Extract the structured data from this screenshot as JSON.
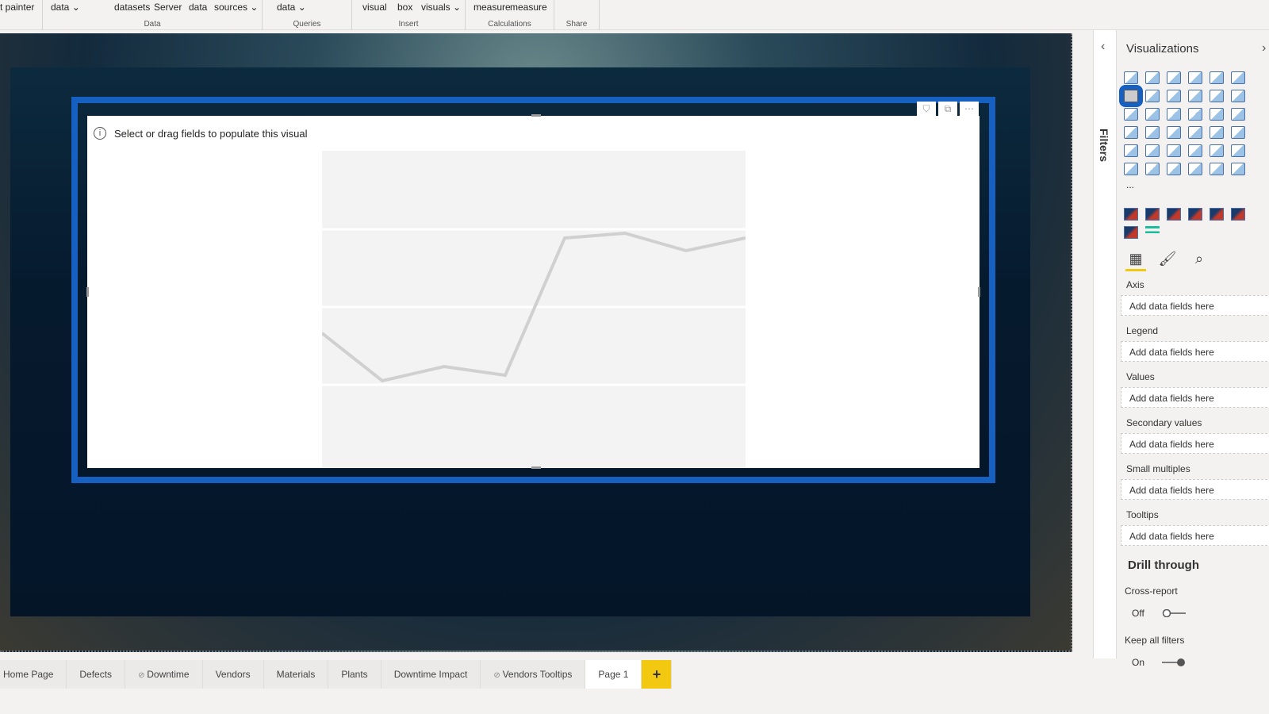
{
  "ribbon": {
    "groups": [
      {
        "label": "",
        "items": [
          "t painter"
        ]
      },
      {
        "label": "Data",
        "items": [
          "data ⌄",
          "datasets",
          "Server",
          "data",
          "sources ⌄"
        ]
      },
      {
        "label": "Queries",
        "items": [
          "data ⌄"
        ]
      },
      {
        "label": "Insert",
        "items": [
          "visual",
          "box",
          "visuals ⌄"
        ]
      },
      {
        "label": "Calculations",
        "items": [
          "measure",
          "measure"
        ]
      },
      {
        "label": "Share",
        "items": []
      }
    ]
  },
  "visual": {
    "message": "Select or drag fields to populate this visual",
    "info_icon": "i",
    "header": [
      "filter-icon",
      "focus-mode-icon",
      "more-options-icon"
    ],
    "more": "⋯"
  },
  "filters": {
    "label": "Filters",
    "collapse": "‹"
  },
  "viz": {
    "title": "Visualizations",
    "close": "›",
    "more": "...",
    "selected": "line-chart",
    "wells": [
      {
        "label": "Axis",
        "placeholder": "Add data fields here"
      },
      {
        "label": "Legend",
        "placeholder": "Add data fields here"
      },
      {
        "label": "Values",
        "placeholder": "Add data fields here"
      },
      {
        "label": "Secondary values",
        "placeholder": "Add data fields here"
      },
      {
        "label": "Small multiples",
        "placeholder": "Add data fields here"
      },
      {
        "label": "Tooltips",
        "placeholder": "Add data fields here"
      }
    ],
    "drill_through": "Drill through",
    "cross_report": {
      "label": "Cross-report",
      "state": "Off"
    },
    "keep_all_filters": {
      "label": "Keep all filters",
      "state": "On"
    }
  },
  "pages": {
    "tabs": [
      {
        "label": "Home Page",
        "hidden": false
      },
      {
        "label": "Defects",
        "hidden": false
      },
      {
        "label": "Downtime",
        "hidden": true
      },
      {
        "label": "Vendors",
        "hidden": false
      },
      {
        "label": "Materials",
        "hidden": false
      },
      {
        "label": "Plants",
        "hidden": false
      },
      {
        "label": "Downtime Impact",
        "hidden": false
      },
      {
        "label": "Vendors Tooltips",
        "hidden": true
      },
      {
        "label": "Page 1",
        "hidden": false,
        "active": true
      }
    ],
    "add": "+"
  },
  "colors": {
    "accent": "#f2c811",
    "selection": "#1560c0"
  }
}
